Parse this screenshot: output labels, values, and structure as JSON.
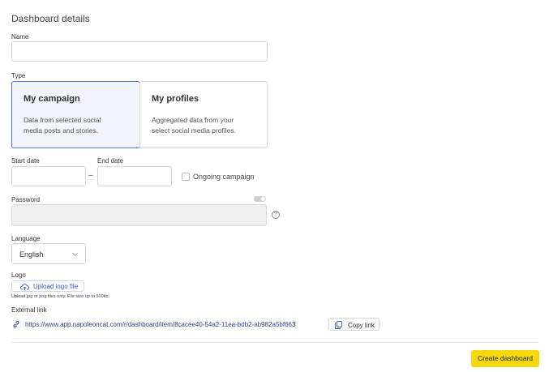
{
  "header": {
    "title": "Dashboard details"
  },
  "name_field": {
    "label": "Name",
    "value": "",
    "placeholder": ""
  },
  "type_field": {
    "label": "Type",
    "options": [
      {
        "title": "My campaign",
        "desc_line1": "Data from selected social",
        "desc_line2": "media posts and stories.",
        "selected": true
      },
      {
        "title": "My profiles",
        "desc_line1": "Aggregated data from your",
        "desc_line2": "select social media profiles.",
        "selected": false
      }
    ]
  },
  "dates": {
    "start_label": "Start date",
    "end_label": "End date",
    "separator": "–",
    "start_value": "",
    "end_value": "",
    "ongoing_label": "Ongoing campaign"
  },
  "password": {
    "label": "Password",
    "enabled": false,
    "value": "",
    "help_glyph": "?"
  },
  "language": {
    "label": "Language",
    "selected": "English"
  },
  "logo": {
    "label": "Logo",
    "upload_label": "Upload logo file",
    "hint": "Upload jpg or png files only. File size up to 500kb."
  },
  "external_link": {
    "label": "External link",
    "url": "https://www.app.napoleoncat.com/r/dashboard/item/8cacee40-54a2-11ea-bdb2-ab982a5bf663",
    "copy_label": "Copy link"
  },
  "footer": {
    "create_label": "Create dashboard"
  },
  "colors": {
    "accent": "#5b74d8",
    "primary_button": "#f5d90a",
    "link": "#2f3e94"
  },
  "icons": {
    "upload": "cloud-upload-icon",
    "link": "link-icon",
    "copy": "copy-icon",
    "help": "help-icon"
  }
}
